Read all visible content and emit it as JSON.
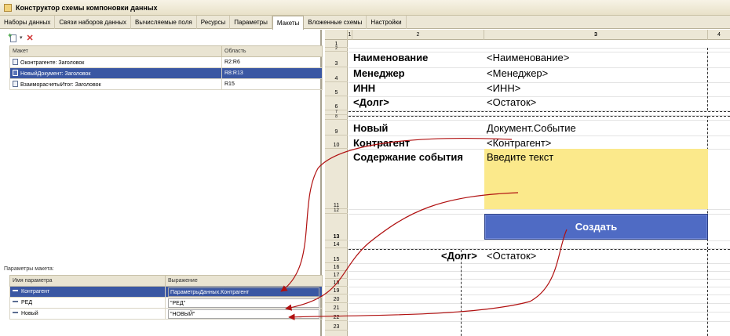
{
  "window": {
    "title": "Конструктор схемы компоновки данных"
  },
  "tabs": [
    {
      "label": "Наборы данных"
    },
    {
      "label": "Связи наборов данных"
    },
    {
      "label": "Вычисляемые поля"
    },
    {
      "label": "Ресурсы"
    },
    {
      "label": "Параметры"
    },
    {
      "label": "Макеты"
    },
    {
      "label": "Вложенные схемы"
    },
    {
      "label": "Настройки"
    }
  ],
  "active_tab": "Макеты",
  "toolbar": {
    "add_icon": "add-layout-icon",
    "delete_icon": "delete-icon"
  },
  "layouts_table": {
    "columns": [
      "Макет",
      "Область"
    ],
    "rows": [
      {
        "name": "Оконтрагенте: Заголовок",
        "area": "R2:R6"
      },
      {
        "name": "НовыйДокумент: Заголовок",
        "area": "R8:R13"
      },
      {
        "name": "ВзаиморасчетыИтог: Заголовок",
        "area": "R15"
      }
    ],
    "selected_index": 1
  },
  "params_label": "Параметры макета:",
  "params_table": {
    "columns": [
      "Имя параметра",
      "Выражение"
    ],
    "rows": [
      {
        "name": "Контрагент",
        "expression": "ПараметрыДанных.Контрагент"
      },
      {
        "name": "РЕД",
        "expression": "\"РЕД\""
      },
      {
        "name": "Новый",
        "expression": "\"НОВЫЙ\""
      }
    ],
    "selected_index": 0
  },
  "sheet": {
    "columns": [
      "1",
      "2",
      "3",
      "4"
    ],
    "rows": [
      "1",
      "2",
      "3",
      "4",
      "5",
      "6",
      "7",
      "8",
      "9",
      "10",
      "11",
      "12",
      "13",
      "14",
      "15",
      "16",
      "17",
      "18",
      "19",
      "20",
      "21",
      "22",
      "23"
    ],
    "cells": {
      "r3c2": "Наименование",
      "r3c3": "<Наименование>",
      "r4c2": "Менеджер",
      "r4c3": "<Менеджер>",
      "r5c2": "ИНН",
      "r5c3": "<ИНН>",
      "r6c2": "<Долг>",
      "r6c3": "<Остаток>",
      "r9c2": "Новый",
      "r9c3": "Документ.Событие",
      "r10c2": "Контрагент",
      "r10c3": "<Контрагент>",
      "r11c2": "Содержание события",
      "r11c3": "Введите текст",
      "r13c3": "Создать",
      "r15c2": "<Долг>",
      "r15c3": "<Остаток>"
    }
  },
  "colors": {
    "accent": "#3a57a3",
    "button": "#4f6bc4",
    "input_fill": "#fbe98b",
    "arrows": "#b01010"
  }
}
